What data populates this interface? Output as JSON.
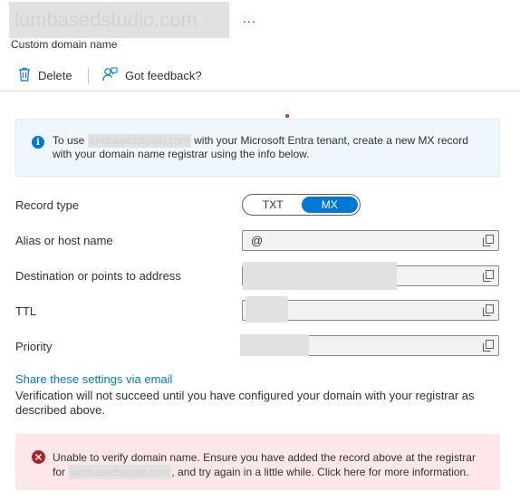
{
  "header": {
    "title": "lumbasedstudio.com",
    "more_label": "...",
    "subtitle": "Custom domain name"
  },
  "toolbar": {
    "delete_label": "Delete",
    "feedback_label": "Got feedback?"
  },
  "info": {
    "prefix": "To use",
    "domain": "lumbasedstudio.com",
    "suffix": "with your Microsoft Entra tenant, create a new MX record with your domain name registrar using the info below."
  },
  "record": {
    "type_label": "Record type",
    "options": [
      "TXT",
      "MX"
    ],
    "selected": "MX",
    "alias_label": "Alias or host name",
    "alias_value": "@",
    "destination_label": "Destination or points to address",
    "ttl_label": "TTL",
    "priority_label": "Priority"
  },
  "share_link": "Share these settings via email",
  "verification_note": "Verification will not succeed until you have configured your domain with your registrar as described above.",
  "error": {
    "prefix": "Unable to verify domain name. Ensure you have added the record above at the registrar for",
    "domain": "lumbasedstudio.com",
    "suffix": ", and try again in a little while. Click here for more information."
  },
  "colors": {
    "accent": "#0078d4",
    "info_bg": "#eff6fc",
    "error_bg": "#fde7e9",
    "error_icon": "#a4262c"
  }
}
